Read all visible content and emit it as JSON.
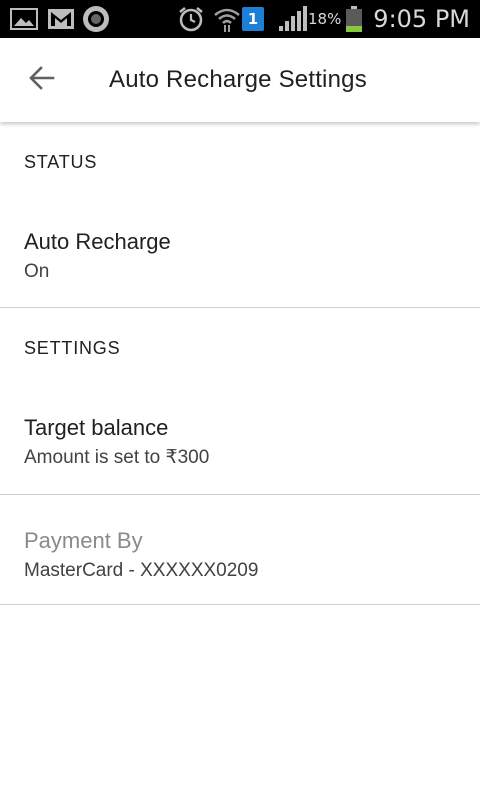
{
  "status_bar": {
    "icons": [
      "gallery-icon",
      "gmail-icon",
      "circle-app-icon",
      "alarm-icon",
      "wifi-icon",
      "notification-badge-icon",
      "signal-icon",
      "battery-icon"
    ],
    "notification_count": "1",
    "battery_percent": "18%",
    "time": "9:05 PM"
  },
  "app_bar": {
    "back_icon": "arrow-back-icon",
    "title": "Auto Recharge Settings"
  },
  "sections": {
    "status": {
      "header": "STATUS",
      "auto_recharge": {
        "title": "Auto Recharge",
        "summary": "On"
      }
    },
    "settings": {
      "header": "SETTINGS",
      "target_balance": {
        "title": "Target balance",
        "summary": "Amount is set to ₹300"
      },
      "payment_by": {
        "title": "Payment By",
        "summary": "MasterCard - XXXXXX0209"
      }
    }
  },
  "colors": {
    "status_bar_bg": "#000000",
    "primary_text": "#212121",
    "disabled_text": "#8a8a8a",
    "divider": "#cfcfcf",
    "battery_fill": "#8cc63f"
  }
}
